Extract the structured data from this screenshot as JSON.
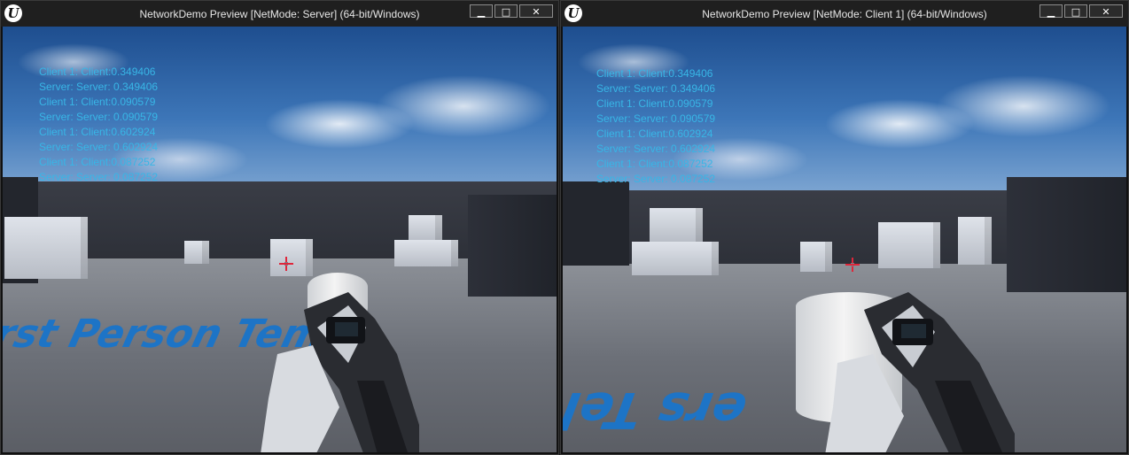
{
  "colors": {
    "debug_text": "#38b6e6",
    "titlebar_bg": "#1f1f1f",
    "crosshair": "#e0263a",
    "floor_text": "#1d74c6"
  },
  "windows": [
    {
      "id": "server",
      "title": "NetworkDemo Preview [NetMode: Server]  (64-bit/Windows)",
      "logo_icon": "unreal-engine-logo",
      "buttons": {
        "minimize": "▁",
        "maximize": "□",
        "close": "✕"
      },
      "floor_text": "rst Person Tem",
      "debug_log": [
        "Client 1: Client:0.349406",
        "Server: Server: 0.349406",
        "Client 1: Client:0.090579",
        "Server: Server: 0.090579",
        "Client 1: Client:0.602924",
        "Server: Server: 0.602924",
        "Client 1: Client:0.087252",
        "Server: Server: 0.087252"
      ]
    },
    {
      "id": "client1",
      "title": "NetworkDemo Preview [NetMode: Client 1]  (64-bit/Windows)",
      "logo_icon": "unreal-engine-logo",
      "buttons": {
        "minimize": "▁",
        "maximize": "□",
        "close": "✕"
      },
      "floor_text": "ers Tel",
      "debug_log": [
        "Client 1: Client:0.349406",
        "Server: Server: 0.349406",
        "Client 1: Client:0.090579",
        "Server: Server: 0.090579",
        "Client 1: Client:0.602924",
        "Server: Server: 0.602924",
        "Client 1: Client:0.087252",
        "Server: Server: 0.087252"
      ]
    }
  ]
}
